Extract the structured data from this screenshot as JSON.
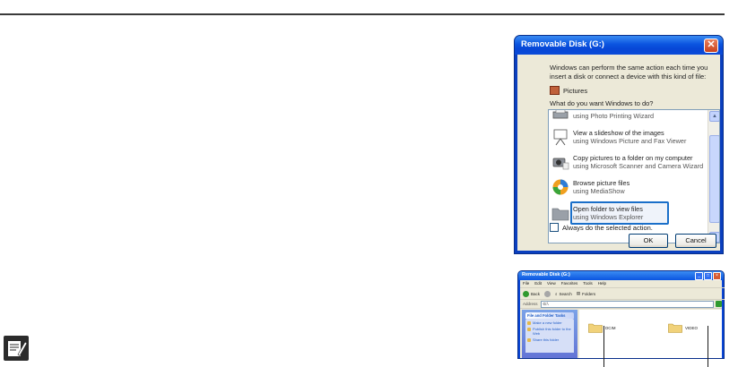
{
  "dialog": {
    "title": "Removable Disk (G:)",
    "close_glyph": "✕",
    "message": "Windows can perform the same action each time you insert a disk or connect a device with this kind of file:",
    "content_type": "Pictures",
    "question": "What do you want Windows to do?",
    "options": [
      {
        "line1": "",
        "line2": "using Photo Printing Wizard",
        "icon": "printer-icon"
      },
      {
        "line1": "View a slideshow of the images",
        "line2": "using Windows Picture and Fax Viewer",
        "icon": "slideshow-projector-icon"
      },
      {
        "line1": "Copy pictures to a folder on my computer",
        "line2": "using Microsoft Scanner and Camera Wizard",
        "icon": "camera-wizard-icon"
      },
      {
        "line1": "Browse picture files",
        "line2": "using MediaShow",
        "icon": "mediashow-icon"
      },
      {
        "line1": "Open folder to view files",
        "line2": "using Windows Explorer",
        "icon": "folder-icon"
      }
    ],
    "selected_option": 4,
    "always_label": "Always do the selected action.",
    "ok_label": "OK",
    "cancel_label": "Cancel"
  },
  "explorer": {
    "title": "Removable Disk (G:)",
    "menu": [
      "File",
      "Edit",
      "View",
      "Favorites",
      "Tools",
      "Help"
    ],
    "toolbar": {
      "back": "Back",
      "search": "Search",
      "folders": "Folders"
    },
    "address_label": "Address",
    "address_value": "G:\\",
    "go_label": "Go",
    "task_pane_title": "File and Folder Tasks",
    "tasks": [
      "Make a new folder",
      "Publish this folder to the Web",
      "Share this folder"
    ],
    "folders": [
      "DCIM",
      "VIDEO"
    ]
  },
  "colors": {
    "accent": "#1a6fc9",
    "titlebar": "#0b55e0",
    "dialog_bg": "#ece9d8"
  }
}
